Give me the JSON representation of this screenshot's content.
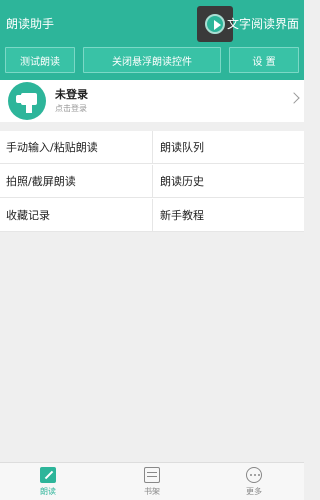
{
  "header": {
    "app_title": "朗读助手",
    "right_title": "文字阅读界面",
    "buttons": [
      "测试朗读",
      "关闭悬浮朗读控件",
      "设 置"
    ]
  },
  "profile": {
    "name": "未登录",
    "subtitle": "点击登录"
  },
  "menu": [
    [
      "手动输入/粘贴朗读",
      "朗读队列"
    ],
    [
      "拍照/截屏朗读",
      "朗读历史"
    ],
    [
      "收藏记录",
      "新手教程"
    ]
  ],
  "tabs": [
    {
      "label": "朗读",
      "icon": "read-icon",
      "active": true
    },
    {
      "label": "书架",
      "icon": "bookshelf-icon",
      "active": false
    },
    {
      "label": "更多",
      "icon": "more-icon",
      "active": false
    }
  ],
  "colors": {
    "accent": "#2db59a",
    "button": "#39c2a6",
    "background": "#efefef"
  }
}
